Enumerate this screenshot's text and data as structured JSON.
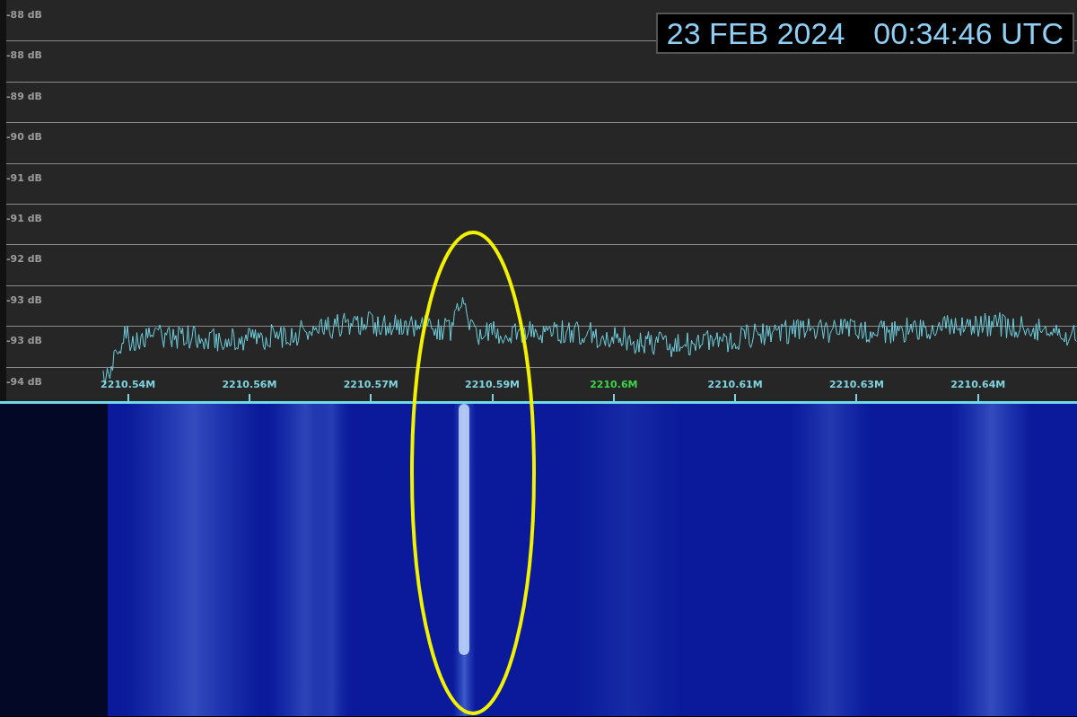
{
  "timestamp": {
    "date": "23 FEB 2024",
    "time": "00:34:46 UTC"
  },
  "db_labels": [
    "-88 dB",
    "-88 dB",
    "-89 dB",
    "-90 dB",
    "-91 dB",
    "-91 dB",
    "-92 dB",
    "-93 dB",
    "-93 dB",
    "-94 dB"
  ],
  "frequency_labels": [
    {
      "label": "2210.54M",
      "center": false
    },
    {
      "label": "2210.56M",
      "center": false
    },
    {
      "label": "2210.57M",
      "center": false
    },
    {
      "label": "2210.59M",
      "center": false
    },
    {
      "label": "2210.6M",
      "center": true
    },
    {
      "label": "2210.61M",
      "center": false
    },
    {
      "label": "2210.63M",
      "center": false
    },
    {
      "label": "2210.64M",
      "center": false
    }
  ]
}
